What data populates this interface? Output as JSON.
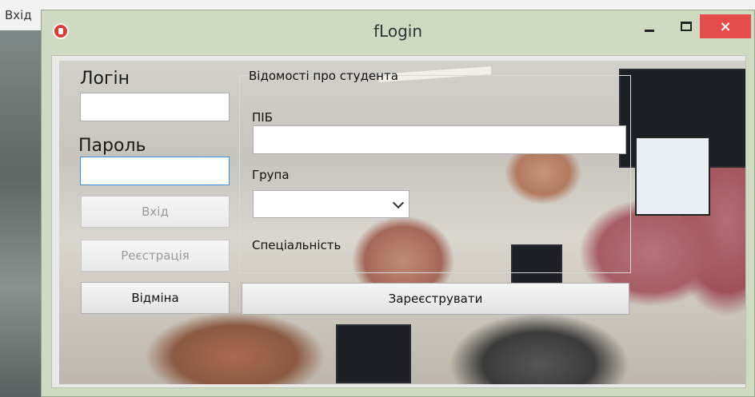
{
  "background_window": {
    "title": "Вхід"
  },
  "window": {
    "title": "fLogin",
    "close_label": "×"
  },
  "login": {
    "login_label": "Логін",
    "login_value": "",
    "password_label": "Пароль",
    "password_value": "",
    "enter_button": "Вхід",
    "register_button": "Реєстрація",
    "cancel_button": "Відміна"
  },
  "student": {
    "group_title": "Відомості про студента",
    "name_label": "ПІБ",
    "name_value": "",
    "group_label": "Група",
    "group_selected": "",
    "specialty_label": "Спеціальність",
    "submit_button": "Зареєструвати"
  },
  "colors": {
    "window_frame": "#cfdbc1",
    "close_button": "#e74c4c",
    "focus_border": "#3c8fdc"
  }
}
